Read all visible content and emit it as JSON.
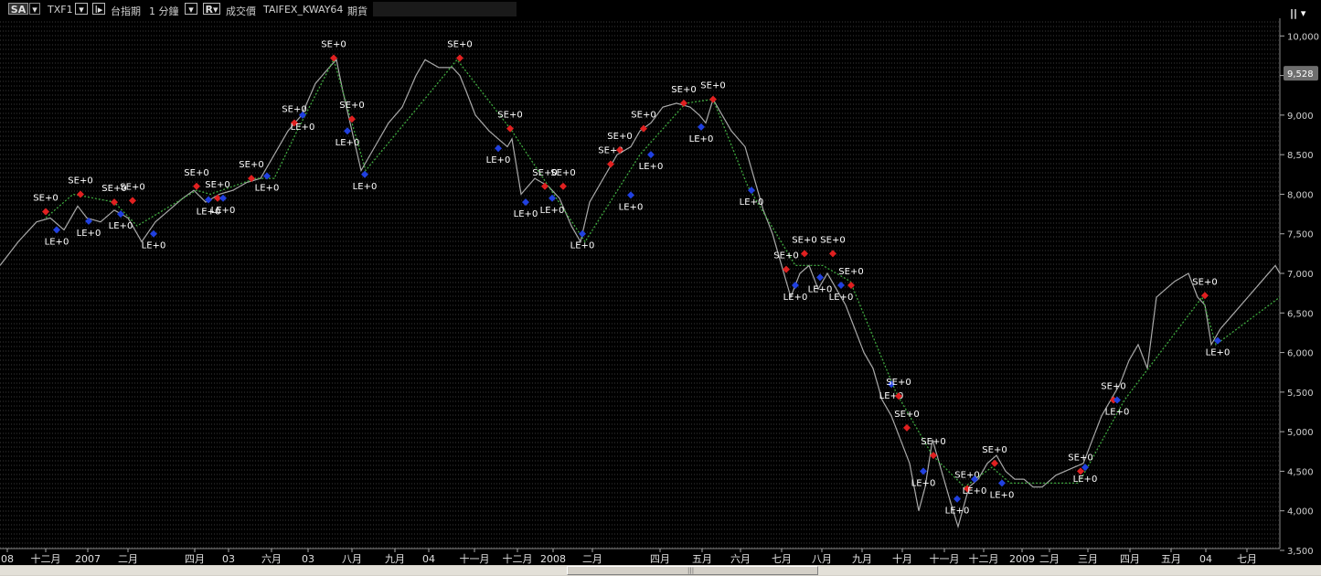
{
  "toolbar": {
    "sa_label": "SA",
    "dropdown_glyph": "▾",
    "symbol": "TXF1",
    "bars_glyph": "I▸",
    "product": "台指期",
    "period": "1 分鐘",
    "price_btn": "R▾",
    "price_type": "成交價",
    "strategy": "TAIFEX_KWAY64",
    "contract": "期貨",
    "menu_icon": "|| ▾",
    "colors": {
      "background": "#000000",
      "price": "#aaaaaa",
      "signal_line": "#4caf50",
      "entry_short": "#e02020",
      "entry_long": "#2040e0"
    }
  },
  "chart_data": {
    "type": "line",
    "title": "",
    "ylim": [
      3500,
      10200
    ],
    "y_ticks": [
      3500,
      4000,
      4500,
      5000,
      5500,
      6000,
      6500,
      7000,
      7500,
      8000,
      8500,
      9000,
      9500,
      10000
    ],
    "y_tick_labels": [
      "3,500",
      "4,000",
      "4,500",
      "5,000",
      "5,500",
      "6,000",
      "6,500",
      "7,000",
      "7,500",
      "8,000",
      "8,500",
      "9,000",
      "9,500",
      "10,000"
    ],
    "last_price": 9528,
    "last_price_label": "9,528",
    "x_labels": [
      {
        "t": 8,
        "label": "08"
      },
      {
        "t": 50,
        "label": "十二月"
      },
      {
        "t": 96,
        "label": "2007"
      },
      {
        "t": 140,
        "label": "二月"
      },
      {
        "t": 213,
        "label": "四月"
      },
      {
        "t": 250,
        "label": "03"
      },
      {
        "t": 297,
        "label": "六月"
      },
      {
        "t": 337,
        "label": "03"
      },
      {
        "t": 385,
        "label": "八月"
      },
      {
        "t": 432,
        "label": "九月"
      },
      {
        "t": 469,
        "label": "04"
      },
      {
        "t": 519,
        "label": "十一月"
      },
      {
        "t": 566,
        "label": "十二月"
      },
      {
        "t": 605,
        "label": "2008"
      },
      {
        "t": 648,
        "label": "二月"
      },
      {
        "t": 722,
        "label": "四月"
      },
      {
        "t": 768,
        "label": "五月"
      },
      {
        "t": 810,
        "label": "六月"
      },
      {
        "t": 855,
        "label": "七月"
      },
      {
        "t": 899,
        "label": "八月"
      },
      {
        "t": 943,
        "label": "九月"
      },
      {
        "t": 987,
        "label": "十月"
      },
      {
        "t": 1033,
        "label": "十一月"
      },
      {
        "t": 1076,
        "label": "十二月"
      },
      {
        "t": 1118,
        "label": "2009"
      },
      {
        "t": 1148,
        "label": "二月"
      },
      {
        "t": 1190,
        "label": "三月"
      },
      {
        "t": 1236,
        "label": "四月"
      },
      {
        "t": 1281,
        "label": "五月"
      },
      {
        "t": 1319,
        "label": "04"
      },
      {
        "t": 1364,
        "label": "七月"
      }
    ],
    "series": [
      {
        "x": [
          0,
          20,
          40,
          55,
          70,
          85,
          95,
          110,
          125,
          140,
          155,
          170,
          185,
          200,
          212,
          225,
          240,
          255,
          270,
          285,
          300,
          315,
          330,
          345,
          360,
          368,
          375,
          385,
          395,
          410,
          425,
          440,
          455,
          465,
          480,
          495,
          503,
          510,
          520,
          535,
          545,
          555,
          560,
          570,
          585,
          600,
          612,
          625,
          635,
          645,
          660,
          675,
          690,
          700,
          712,
          725,
          740,
          755,
          765,
          772,
          780,
          790,
          800,
          815,
          825,
          835,
          845,
          855,
          865,
          875,
          885,
          895,
          905,
          915,
          925,
          935,
          945,
          955,
          965,
          975,
          985,
          995,
          1005,
          1012,
          1020,
          1030,
          1040,
          1048,
          1060,
          1070,
          1080,
          1090,
          1100,
          1110,
          1120,
          1130,
          1140,
          1155,
          1165,
          1175,
          1185,
          1195,
          1205,
          1215,
          1225,
          1235,
          1245,
          1255,
          1265,
          1275,
          1285,
          1300,
          1310,
          1318,
          1325,
          1335,
          1350,
          1365,
          1380,
          1395,
          1400
        ],
        "y": [
          7100,
          7400,
          7650,
          7700,
          7550,
          7850,
          7700,
          7650,
          7800,
          7700,
          7400,
          7650,
          7800,
          7950,
          8050,
          7900,
          8000,
          8050,
          8150,
          8200,
          8500,
          8800,
          9000,
          9400,
          9600,
          9700,
          9300,
          8800,
          8300,
          8600,
          8900,
          9100,
          9500,
          9700,
          9600,
          9600,
          9500,
          9300,
          9000,
          8800,
          8700,
          8600,
          8700,
          8000,
          8200,
          8100,
          7950,
          7600,
          7400,
          7900,
          8200,
          8500,
          8600,
          8800,
          8900,
          9100,
          9150,
          9100,
          9000,
          8900,
          9200,
          9000,
          8800,
          8600,
          8200,
          7800,
          7500,
          7100,
          6700,
          7000,
          7100,
          6800,
          7000,
          6800,
          6600,
          6300,
          6000,
          5800,
          5400,
          5200,
          4900,
          4600,
          4000,
          4300,
          4900,
          4500,
          4100,
          3800,
          4300,
          4400,
          4600,
          4700,
          4500,
          4400,
          4400,
          4300,
          4300,
          4450,
          4500,
          4550,
          4600,
          4900,
          5200,
          5400,
          5600,
          5900,
          6100,
          5800,
          6700,
          6800,
          6900,
          7000,
          6700,
          6600,
          6100,
          6300,
          6500,
          6700,
          6900,
          7100,
          7000
        ]
      },
      {
        "name": "signal",
        "x": [
          50,
          80,
          125,
          150,
          215,
          230,
          280,
          300,
          325,
          365,
          385,
          400,
          500,
          560,
          640,
          700,
          750,
          780,
          818,
          870,
          900,
          930,
          980,
          1020,
          1055,
          1085,
          1105,
          1180,
          1230,
          1315,
          1330,
          1400
        ],
        "y": [
          7700,
          8000,
          7900,
          7600,
          8050,
          8000,
          8200,
          8200,
          8800,
          9700,
          8900,
          8300,
          9700,
          8800,
          7400,
          8500,
          9150,
          9200,
          8100,
          7100,
          7100,
          6900,
          5500,
          4700,
          4300,
          4550,
          4350,
          4350,
          5400,
          6700,
          6100,
          6700
        ]
      }
    ],
    "signals": [
      {
        "t": 50,
        "v": 7780,
        "side": "short",
        "label": "SE+0"
      },
      {
        "t": 62,
        "v": 7550,
        "side": "long",
        "label": "LE+0"
      },
      {
        "t": 88,
        "v": 8000,
        "side": "short",
        "label": "SE+0"
      },
      {
        "t": 97,
        "v": 7660,
        "side": "long",
        "label": "LE+0"
      },
      {
        "t": 125,
        "v": 7900,
        "side": "short",
        "label": "SE+0"
      },
      {
        "t": 132,
        "v": 7750,
        "side": "long",
        "label": "LE+0"
      },
      {
        "t": 145,
        "v": 7920,
        "side": "short",
        "label": "SE+0"
      },
      {
        "t": 168,
        "v": 7500,
        "side": "long",
        "label": "LE+0"
      },
      {
        "t": 215,
        "v": 8100,
        "side": "short",
        "label": "SE+0"
      },
      {
        "t": 228,
        "v": 7930,
        "side": "long",
        "label": "LE+0"
      },
      {
        "t": 238,
        "v": 7950,
        "side": "short",
        "label": "SE+0"
      },
      {
        "t": 244,
        "v": 7950,
        "side": "long",
        "label": "LE+0"
      },
      {
        "t": 275,
        "v": 8200,
        "side": "short",
        "label": "SE+0"
      },
      {
        "t": 292,
        "v": 8230,
        "side": "long",
        "label": "LE+0"
      },
      {
        "t": 322,
        "v": 8900,
        "side": "short",
        "label": "SE+0"
      },
      {
        "t": 331,
        "v": 9000,
        "side": "long",
        "label": "LE+0"
      },
      {
        "t": 365,
        "v": 9720,
        "side": "short",
        "label": "SE+0"
      },
      {
        "t": 385,
        "v": 8950,
        "side": "short",
        "label": "SE+0"
      },
      {
        "t": 380,
        "v": 8800,
        "side": "long",
        "label": "LE+0"
      },
      {
        "t": 399,
        "v": 8250,
        "side": "long",
        "label": "LE+0"
      },
      {
        "t": 503,
        "v": 9720,
        "side": "short",
        "label": "SE+0"
      },
      {
        "t": 558,
        "v": 8830,
        "side": "short",
        "label": "SE+0"
      },
      {
        "t": 545,
        "v": 8580,
        "side": "long",
        "label": "LE+0"
      },
      {
        "t": 575,
        "v": 7900,
        "side": "long",
        "label": "LE+0"
      },
      {
        "t": 596,
        "v": 8100,
        "side": "short",
        "label": "SE+0"
      },
      {
        "t": 616,
        "v": 8100,
        "side": "short",
        "label": "SE+0"
      },
      {
        "t": 604,
        "v": 7950,
        "side": "long",
        "label": "LE+0"
      },
      {
        "t": 637,
        "v": 7500,
        "side": "long",
        "label": "LE+0"
      },
      {
        "t": 668,
        "v": 8380,
        "side": "short",
        "label": "SE+0"
      },
      {
        "t": 678,
        "v": 8560,
        "side": "short",
        "label": "SE+0"
      },
      {
        "t": 704,
        "v": 8830,
        "side": "short",
        "label": "SE+0"
      },
      {
        "t": 690,
        "v": 7990,
        "side": "long",
        "label": "LE+0"
      },
      {
        "t": 712,
        "v": 8500,
        "side": "long",
        "label": "LE+0"
      },
      {
        "t": 748,
        "v": 9150,
        "side": "short",
        "label": "SE+0"
      },
      {
        "t": 780,
        "v": 9200,
        "side": "short",
        "label": "SE+0"
      },
      {
        "t": 767,
        "v": 8850,
        "side": "long",
        "label": "LE+0"
      },
      {
        "t": 822,
        "v": 8050,
        "side": "long",
        "label": "LE+0"
      },
      {
        "t": 860,
        "v": 7050,
        "side": "short",
        "label": "SE+0"
      },
      {
        "t": 880,
        "v": 7250,
        "side": "short",
        "label": "SE+0"
      },
      {
        "t": 911,
        "v": 7250,
        "side": "short",
        "label": "SE+0"
      },
      {
        "t": 931,
        "v": 6850,
        "side": "short",
        "label": "SE+0"
      },
      {
        "t": 870,
        "v": 6850,
        "side": "long",
        "label": "LE+0"
      },
      {
        "t": 897,
        "v": 6950,
        "side": "long",
        "label": "LE+0"
      },
      {
        "t": 920,
        "v": 6850,
        "side": "long",
        "label": "LE+0"
      },
      {
        "t": 975,
        "v": 5600,
        "side": "long",
        "label": "LE+0"
      },
      {
        "t": 983,
        "v": 5450,
        "side": "short",
        "label": "SE+0"
      },
      {
        "t": 992,
        "v": 5050,
        "side": "short",
        "label": "SE+0"
      },
      {
        "t": 1010,
        "v": 4500,
        "side": "long",
        "label": "LE+0"
      },
      {
        "t": 1021,
        "v": 4700,
        "side": "short",
        "label": "SE+0"
      },
      {
        "t": 1047,
        "v": 4150,
        "side": "long",
        "label": "LE+0"
      },
      {
        "t": 1058,
        "v": 4280,
        "side": "short",
        "label": "SE+0"
      },
      {
        "t": 1066,
        "v": 4400,
        "side": "long",
        "label": "LE+0"
      },
      {
        "t": 1088,
        "v": 4600,
        "side": "short",
        "label": "SE+0"
      },
      {
        "t": 1096,
        "v": 4350,
        "side": "long",
        "label": "LE+0"
      },
      {
        "t": 1182,
        "v": 4500,
        "side": "short",
        "label": "SE+0"
      },
      {
        "t": 1187,
        "v": 4550,
        "side": "long",
        "label": "LE+0"
      },
      {
        "t": 1218,
        "v": 5400,
        "side": "short",
        "label": "SE+0"
      },
      {
        "t": 1222,
        "v": 5400,
        "side": "long",
        "label": "LE+0"
      },
      {
        "t": 1318,
        "v": 6720,
        "side": "short",
        "label": "SE+0"
      },
      {
        "t": 1332,
        "v": 6150,
        "side": "long",
        "label": "LE+0"
      }
    ]
  }
}
